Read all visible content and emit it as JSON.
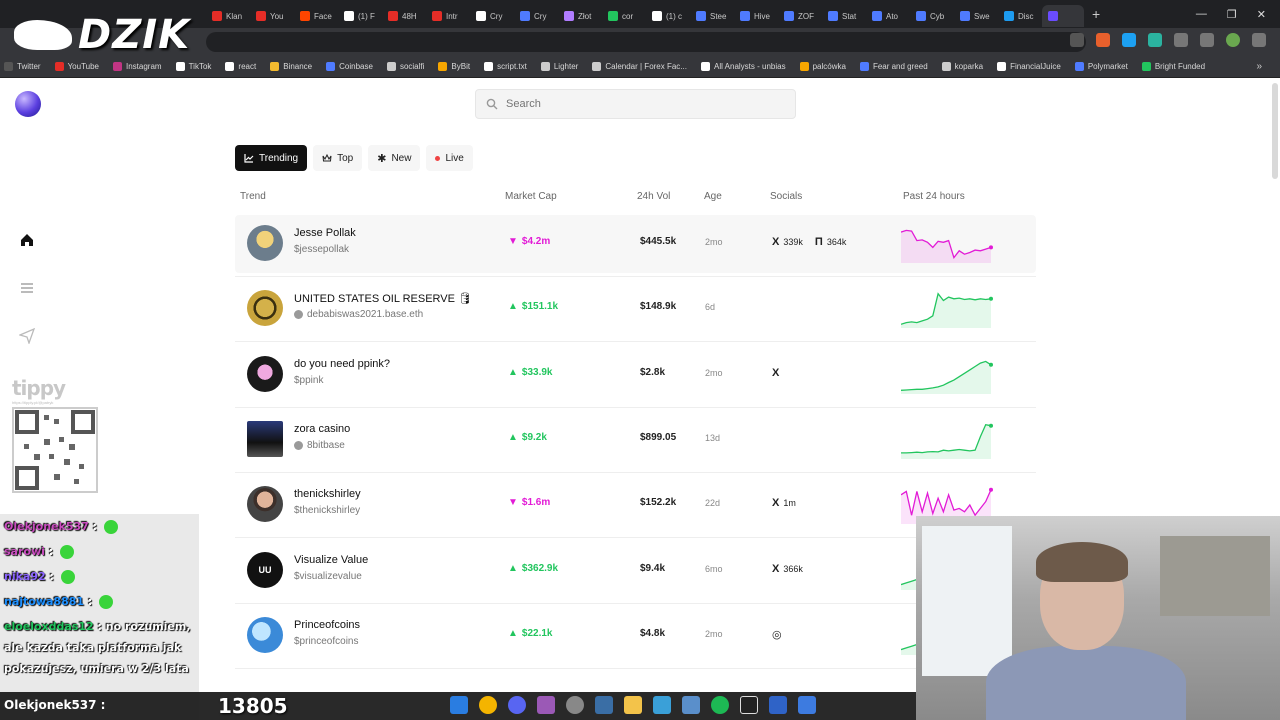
{
  "browser": {
    "tabs": [
      {
        "title": "Klan",
        "color": "#e52d27"
      },
      {
        "title": "You",
        "color": "#e52d27"
      },
      {
        "title": "Face",
        "color": "#ff4500"
      },
      {
        "title": "(1) F",
        "color": "#ffffff"
      },
      {
        "title": "48H",
        "color": "#e52d27"
      },
      {
        "title": "Intr",
        "color": "#e52d27"
      },
      {
        "title": "Cry",
        "color": "#ffffff"
      },
      {
        "title": "Cry",
        "color": "#4f7bff"
      },
      {
        "title": "Złot",
        "color": "#b07cff"
      },
      {
        "title": "cor",
        "color": "#22c55e"
      },
      {
        "title": "(1) c",
        "color": "#ffffff"
      },
      {
        "title": "Stee",
        "color": "#4f7bff"
      },
      {
        "title": "Hive",
        "color": "#4f7bff"
      },
      {
        "title": "ZOF",
        "color": "#4f7bff"
      },
      {
        "title": "Stat",
        "color": "#4f7bff"
      },
      {
        "title": "Ato",
        "color": "#4f7bff"
      },
      {
        "title": "Cyb",
        "color": "#4f7bff"
      },
      {
        "title": "Swe",
        "color": "#4f7bff"
      },
      {
        "title": "Disc",
        "color": "#1d9bf0"
      },
      {
        "title": "",
        "color": "#6a4cff"
      }
    ],
    "bookmarks": [
      {
        "label": "Twitter",
        "color": "#555555"
      },
      {
        "label": "YouTube",
        "color": "#e52d27"
      },
      {
        "label": "Instagram",
        "color": "#c13584"
      },
      {
        "label": "TikTok",
        "color": "#ffffff"
      },
      {
        "label": "react",
        "color": "#ffffff"
      },
      {
        "label": "Binance",
        "color": "#f3ba2f"
      },
      {
        "label": "Coinbase",
        "color": "#4f7bff"
      },
      {
        "label": "socialfi",
        "color": "#cccccc"
      },
      {
        "label": "ByBit",
        "color": "#f7a600"
      },
      {
        "label": "script.txt",
        "color": "#ffffff"
      },
      {
        "label": "Lighter",
        "color": "#cccccc"
      },
      {
        "label": "Calendar | Forex Fac...",
        "color": "#cccccc"
      },
      {
        "label": "All Analysts - unbias",
        "color": "#ffffff"
      },
      {
        "label": "palcówka",
        "color": "#f7a600"
      },
      {
        "label": "Fear and greed",
        "color": "#4f7bff"
      },
      {
        "label": "koparka",
        "color": "#cccccc"
      },
      {
        "label": "FinancialJuice",
        "color": "#ffffff"
      },
      {
        "label": "Polymarket",
        "color": "#4f7bff"
      },
      {
        "label": "Bright Funded",
        "color": "#22c55e"
      }
    ],
    "more_label": "»"
  },
  "logo": {
    "text": "DZIK"
  },
  "search": {
    "placeholder": "Search"
  },
  "filters": [
    {
      "label": "Trending",
      "icon": "trending-icon",
      "active": true
    },
    {
      "label": "Top",
      "icon": "crown-icon",
      "active": false
    },
    {
      "label": "New",
      "icon": "sparkle-icon",
      "active": false
    },
    {
      "label": "Live",
      "icon": "live-dot-icon",
      "active": false
    }
  ],
  "columns": {
    "trend": "Trend",
    "market_cap": "Market Cap",
    "volume": "24h Vol",
    "age": "Age",
    "socials": "Socials",
    "past": "Past 24 hours"
  },
  "colors": {
    "up": "#22c55e",
    "down": "#e21bd6",
    "dark": "#111111"
  },
  "rows": [
    {
      "name": "Jesse Pollak",
      "handle": "$jessepollak",
      "direction": "down",
      "market_cap": "$4.2m",
      "volume": "$445.5k",
      "age": "2mo",
      "socials": [
        {
          "icon": "x-icon",
          "count": "339k"
        },
        {
          "icon": "farcaster-icon",
          "count": "364k"
        }
      ],
      "spark": [
        0.85,
        0.9,
        0.88,
        0.6,
        0.62,
        0.55,
        0.4,
        0.58,
        0.55,
        0.6,
        0.1,
        0.3,
        0.2,
        0.25,
        0.32,
        0.3,
        0.35,
        0.4
      ]
    },
    {
      "name": "UNITED STATES OIL RESERVE 🛢",
      "handle": "debabiswas2021.base.eth",
      "direction": "up",
      "market_cap": "$151.1k",
      "volume": "$148.9k",
      "age": "6d",
      "socials": [],
      "spark": [
        0.05,
        0.1,
        0.12,
        0.1,
        0.15,
        0.2,
        0.3,
        0.95,
        0.75,
        0.85,
        0.8,
        0.82,
        0.78,
        0.8,
        0.77,
        0.8,
        0.78,
        0.8
      ]
    },
    {
      "name": "do you need ppink?",
      "handle": "$ppink",
      "direction": "up",
      "market_cap": "$33.9k",
      "volume": "$2.8k",
      "age": "2mo",
      "socials": [
        {
          "icon": "x-icon",
          "count": ""
        }
      ],
      "spark": [
        0.05,
        0.06,
        0.07,
        0.08,
        0.08,
        0.1,
        0.12,
        0.15,
        0.2,
        0.28,
        0.35,
        0.45,
        0.55,
        0.65,
        0.75,
        0.85,
        0.9,
        0.8
      ]
    },
    {
      "name": "zora casino",
      "handle": "8bitbase",
      "direction": "up",
      "market_cap": "$9.2k",
      "volume": "$899.05",
      "age": "13d",
      "socials": [],
      "spark": [
        0.12,
        0.12,
        0.13,
        0.14,
        0.13,
        0.15,
        0.16,
        0.15,
        0.2,
        0.18,
        0.2,
        0.22,
        0.2,
        0.18,
        0.2,
        0.6,
        0.95,
        0.92
      ]
    },
    {
      "name": "thenickshirley",
      "handle": "$thenickshirley",
      "direction": "down",
      "market_cap": "$1.6m",
      "volume": "$152.2k",
      "age": "22d",
      "socials": [
        {
          "icon": "x-icon",
          "count": "1m"
        }
      ],
      "spark": [
        0.8,
        0.9,
        0.2,
        0.9,
        0.3,
        0.85,
        0.25,
        0.7,
        0.3,
        0.8,
        0.35,
        0.4,
        0.3,
        0.5,
        0.2,
        0.4,
        0.6,
        0.95
      ]
    },
    {
      "name": "Visualize Value",
      "handle": "$visualizevalue",
      "direction": "up",
      "market_cap": "$362.9k",
      "volume": "$9.4k",
      "age": "6mo",
      "socials": [
        {
          "icon": "x-icon",
          "count": "366k"
        }
      ],
      "spark": [
        0.1,
        0.15,
        0.2,
        0.25,
        0.3,
        0.35,
        0.4,
        0.45,
        0.5,
        0.55,
        0.6,
        0.65,
        0.7,
        0.75,
        0.8,
        0.85,
        0.9,
        0.95
      ]
    },
    {
      "name": "Princeofcoins",
      "handle": "$princeofcoins",
      "direction": "up",
      "market_cap": "$22.1k",
      "volume": "$4.8k",
      "age": "2mo",
      "socials": [
        {
          "icon": "instagram-icon",
          "count": ""
        }
      ],
      "spark": [
        0.1,
        0.15,
        0.2,
        0.25,
        0.3,
        0.35,
        0.4,
        0.45,
        0.5,
        0.55,
        0.6,
        0.65,
        0.7,
        0.75,
        0.8,
        0.85,
        0.9,
        0.95
      ]
    }
  ],
  "overlay": {
    "tippy_title": "tippy",
    "tippy_url": "https://tipply.pl/@patryk",
    "chat": [
      {
        "user": "Olekjonek537",
        "text": "",
        "user_color": "#c94dbf",
        "emote": true
      },
      {
        "user": "sarowi",
        "text": "",
        "user_color": "#c94dbf",
        "emote": true
      },
      {
        "user": "nika92",
        "text": "",
        "user_color": "#8a63ff",
        "emote": true
      },
      {
        "user": "najtowa8881",
        "text": "",
        "user_color": "#1e90ff",
        "emote": true
      },
      {
        "user": "eloeloxddas12",
        "text": "no rozumiem, ale kazda taka platforma jak pokazujesz, umiera w 2/3 lata",
        "user_color": "#22c55e",
        "emote": false
      }
    ],
    "bottom_user": "Olekjonek537 :",
    "bottom_number": "13805"
  }
}
